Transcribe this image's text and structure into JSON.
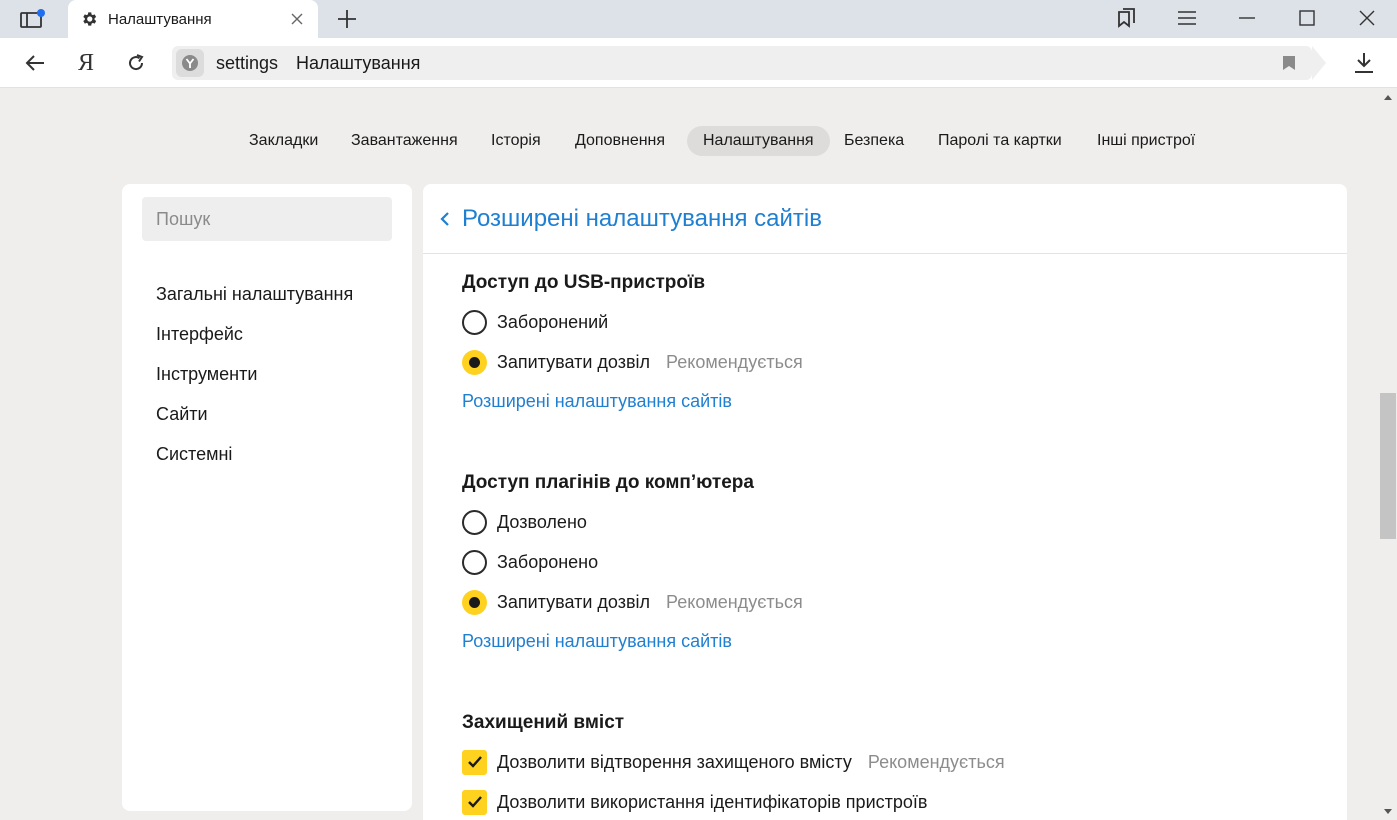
{
  "browser": {
    "tab": {
      "title": "Налаштування"
    },
    "address": {
      "url": "settings",
      "page_title": "Налаштування"
    },
    "brand_letter": "Я"
  },
  "topmenu": {
    "items": [
      {
        "label": "Закладки",
        "active": false
      },
      {
        "label": "Завантаження",
        "active": false
      },
      {
        "label": "Історія",
        "active": false
      },
      {
        "label": "Доповнення",
        "active": false
      },
      {
        "label": "Налаштування",
        "active": true
      },
      {
        "label": "Безпека",
        "active": false
      },
      {
        "label": "Паролі та картки",
        "active": false
      },
      {
        "label": "Інші пристрої",
        "active": false
      }
    ]
  },
  "sidebar": {
    "search_placeholder": "Пошук",
    "items": [
      {
        "label": "Загальні налаштування"
      },
      {
        "label": "Інтерфейс"
      },
      {
        "label": "Інструменти"
      },
      {
        "label": "Сайти"
      },
      {
        "label": "Системні"
      }
    ]
  },
  "main": {
    "title": "Розширені налаштування сайтів",
    "sections": [
      {
        "title": "Доступ до USB-пристроїв",
        "options": [
          {
            "label": "Заборонений",
            "checked": false,
            "note": ""
          },
          {
            "label": "Запитувати дозвіл",
            "checked": true,
            "note": "Рекомендується"
          }
        ],
        "link": "Розширені налаштування сайтів"
      },
      {
        "title": "Доступ плагінів до комп’ютера",
        "options": [
          {
            "label": "Дозволено",
            "checked": false,
            "note": ""
          },
          {
            "label": "Заборонено",
            "checked": false,
            "note": ""
          },
          {
            "label": "Запитувати дозвіл",
            "checked": true,
            "note": "Рекомендується"
          }
        ],
        "link": "Розширені налаштування сайтів"
      },
      {
        "title": "Захищений вміст",
        "checkboxes": [
          {
            "label": "Дозволити відтворення захищеного вмісту",
            "checked": true,
            "note": "Рекомендується"
          },
          {
            "label": "Дозволити використання ідентифікаторів пристроїв",
            "checked": true,
            "note": ""
          }
        ]
      }
    ]
  },
  "colors": {
    "accent_link": "#1f7fd1",
    "accent_yellow": "#ffd21f",
    "page_bg": "#f0eeec",
    "titlebar_bg": "#dde1e8"
  }
}
